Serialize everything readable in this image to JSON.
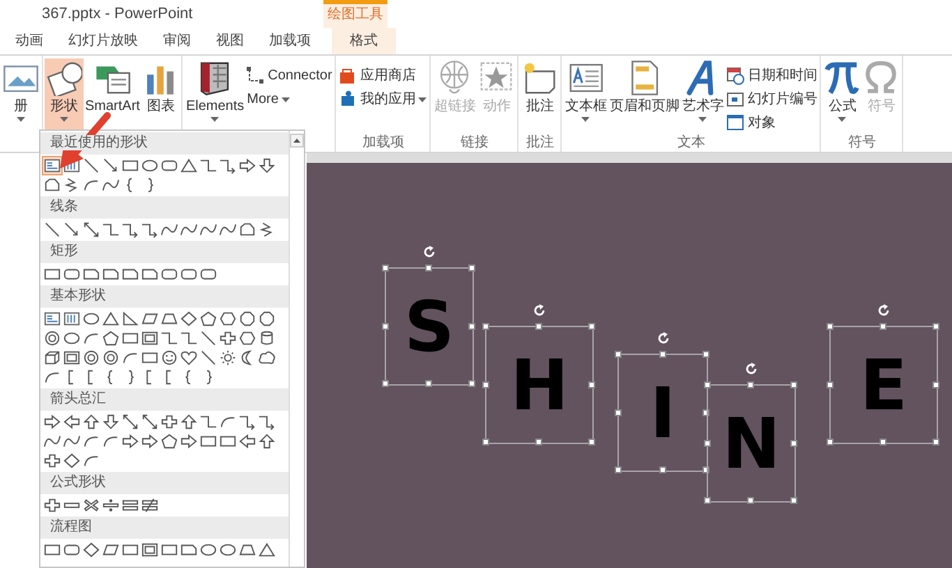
{
  "window": {
    "title": "367.pptx - PowerPoint"
  },
  "contextual_tab": {
    "label": "绘图工具"
  },
  "tabs": [
    {
      "label": "动画",
      "selected": false,
      "contextual": false
    },
    {
      "label": "幻灯片放映",
      "selected": false,
      "contextual": false
    },
    {
      "label": "审阅",
      "selected": false,
      "contextual": false
    },
    {
      "label": "视图",
      "selected": false,
      "contextual": false
    },
    {
      "label": "加载项",
      "selected": false,
      "contextual": false
    },
    {
      "label": "格式",
      "selected": false,
      "contextual": true
    }
  ],
  "ribbon": {
    "groups": [
      {
        "buttons": [
          {
            "kind": "large",
            "label": "册",
            "caret": true,
            "disabled": false,
            "selected": false
          }
        ]
      },
      {
        "buttons": [
          {
            "kind": "large",
            "label": "形状",
            "caret": true,
            "disabled": false,
            "selected": true
          },
          {
            "kind": "large",
            "label": "SmartArt",
            "caret": false,
            "disabled": false,
            "selected": false
          },
          {
            "kind": "large",
            "label": "图表",
            "caret": false,
            "disabled": false,
            "selected": false
          }
        ]
      },
      {
        "buttons": [
          {
            "kind": "large",
            "label": "Elements",
            "caret": true,
            "disabled": false,
            "selected": false
          },
          {
            "kind": "small",
            "label": "Connector",
            "caret": false,
            "disabled": false,
            "selected": false
          },
          {
            "kind": "small",
            "label": "More",
            "caret": true,
            "disabled": false,
            "selected": false
          }
        ]
      },
      {
        "label": "加载项",
        "buttons": [
          {
            "kind": "small",
            "label": "应用商店",
            "caret": false,
            "disabled": false,
            "selected": false
          },
          {
            "kind": "small",
            "label": "我的应用",
            "caret": true,
            "disabled": false,
            "selected": false
          }
        ]
      },
      {
        "label": "链接",
        "buttons": [
          {
            "kind": "large",
            "label": "超链接",
            "caret": false,
            "disabled": true,
            "selected": false
          },
          {
            "kind": "large",
            "label": "动作",
            "caret": false,
            "disabled": true,
            "selected": false
          }
        ]
      },
      {
        "label": "批注",
        "buttons": [
          {
            "kind": "large",
            "label": "批注",
            "caret": false,
            "disabled": false,
            "selected": false
          }
        ]
      },
      {
        "label": "文本",
        "buttons": [
          {
            "kind": "large",
            "label": "文本框",
            "caret": true,
            "disabled": false,
            "selected": false
          },
          {
            "kind": "large",
            "label": "页眉和页脚",
            "caret": false,
            "disabled": false,
            "selected": false
          },
          {
            "kind": "large",
            "label": "艺术字",
            "caret": true,
            "disabled": false,
            "selected": false
          },
          {
            "kind": "small",
            "label": "日期和时间",
            "caret": false,
            "disabled": false,
            "selected": false
          },
          {
            "kind": "small",
            "label": "幻灯片编号",
            "caret": false,
            "disabled": false,
            "selected": false
          },
          {
            "kind": "small",
            "label": "对象",
            "caret": false,
            "disabled": false,
            "selected": false
          }
        ]
      },
      {
        "label": "符号",
        "buttons": [
          {
            "kind": "large",
            "label": "公式",
            "caret": true,
            "disabled": false,
            "selected": false
          },
          {
            "kind": "large",
            "label": "符号",
            "caret": false,
            "disabled": true,
            "selected": false
          }
        ]
      }
    ]
  },
  "shape_gallery": {
    "sections": [
      {
        "title": "最近使用的形状",
        "first_item_highlighted": true
      },
      {
        "title": "线条",
        "first_item_highlighted": false
      },
      {
        "title": "矩形",
        "first_item_highlighted": false
      },
      {
        "title": "基本形状",
        "first_item_highlighted": false
      },
      {
        "title": "箭头总汇",
        "first_item_highlighted": false
      },
      {
        "title": "公式形状",
        "first_item_highlighted": false
      },
      {
        "title": "流程图",
        "first_item_highlighted": false
      }
    ]
  },
  "slide": {
    "shapes": [
      {
        "text": "S",
        "selected": true
      },
      {
        "text": "H",
        "selected": true
      },
      {
        "text": "I",
        "selected": true
      },
      {
        "text": "N",
        "selected": true
      },
      {
        "text": "E",
        "selected": true
      }
    ]
  }
}
